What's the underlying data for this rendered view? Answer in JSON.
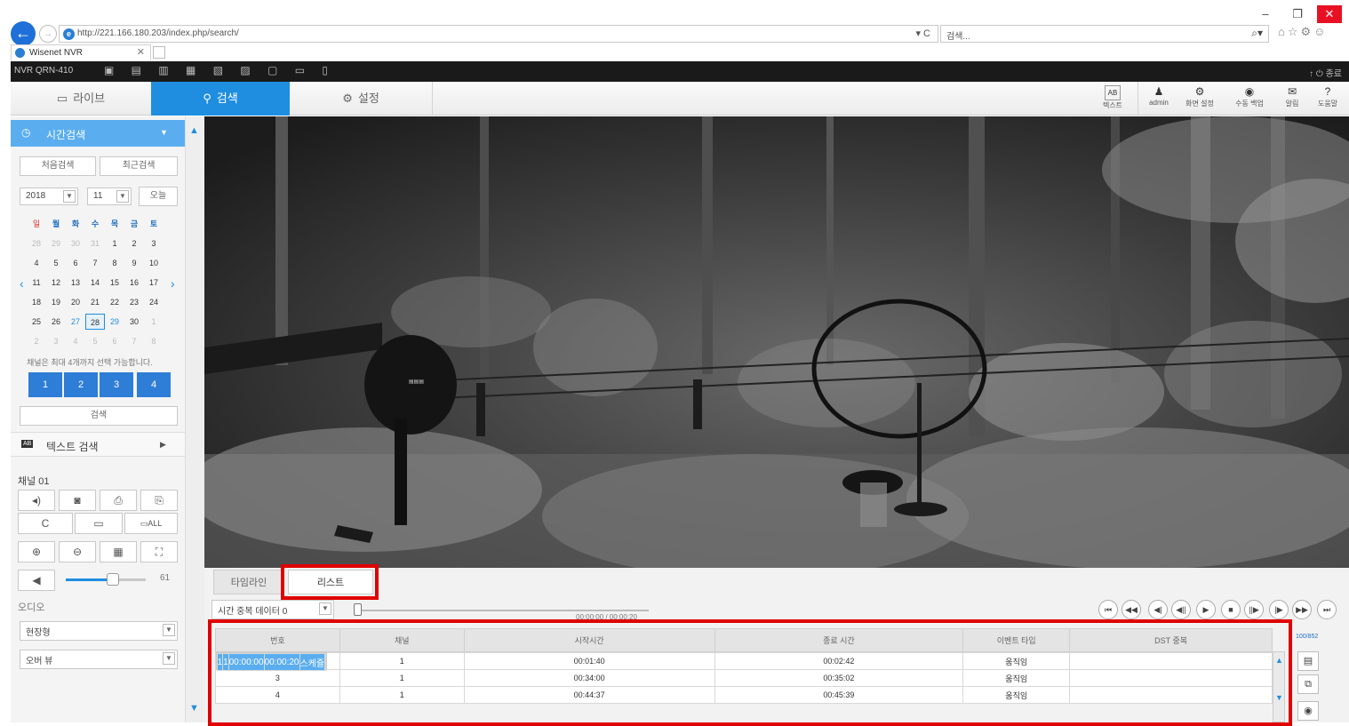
{
  "browser": {
    "url": "http://221.166.180.203/index.php/search/",
    "search_placeholder": "검색...",
    "tab_title": "Wisenet NVR",
    "refresh": "▾ C",
    "search_glyph": "⌕▾",
    "window_minimize": "–",
    "window_restore": "❐",
    "window_close": "✕",
    "tab_close": "✕",
    "toolbar_glyphs": "⌂☆⚙☺"
  },
  "app": {
    "model": "NVR QRN-410",
    "toolbar_glyphs": "▣ ▤ ▥ ▦ ▧ ▨ ▢ ▭ ▯",
    "top_right": "↑ ⏻ 종료"
  },
  "nav": {
    "live_label": "라이브",
    "search_label": "검색",
    "setup_label": "설정",
    "right_buttons": [
      {
        "icon": "AB",
        "label": "텍스트"
      },
      {
        "icon": "♟",
        "label": "admin"
      },
      {
        "icon": "⚙",
        "label": "화면 설정"
      },
      {
        "icon": "◉",
        "label": "수동 백업"
      },
      {
        "icon": "✉",
        "label": "알림"
      },
      {
        "icon": "?",
        "label": "도움말"
      }
    ]
  },
  "left": {
    "section_title": "시간검색",
    "first_search": "처음검색",
    "recent_search": "최근검색",
    "year": "2018",
    "month": "11",
    "today": "오늘",
    "weekdays": [
      "일",
      "월",
      "화",
      "수",
      "목",
      "금",
      "토"
    ],
    "weeks": [
      [
        "28",
        "29",
        "30",
        "31",
        "1",
        "2",
        "3"
      ],
      [
        "4",
        "5",
        "6",
        "7",
        "8",
        "9",
        "10"
      ],
      [
        "11",
        "12",
        "13",
        "14",
        "15",
        "16",
        "17"
      ],
      [
        "18",
        "19",
        "20",
        "21",
        "22",
        "23",
        "24"
      ],
      [
        "25",
        "26",
        "27",
        "28",
        "29",
        "30",
        "1"
      ],
      [
        "2",
        "3",
        "4",
        "5",
        "6",
        "7",
        "8"
      ]
    ],
    "notice": "채널은 최대 4개까지 선택 가능합니다.",
    "channels": [
      "1",
      "2",
      "3",
      "4"
    ],
    "search_btn": "검색",
    "text_search": "텍스트 검색",
    "text_search_icon": "AB",
    "channel_label": "채널 01",
    "volume_value": "61",
    "audio_label": "오디오",
    "dropdown1": "현장형",
    "dropdown2": "오버 뷰",
    "ctrl_glyphs": [
      "◂)",
      "◙",
      "⎙",
      "⎘",
      "C",
      "▭",
      "▭ALL",
      "⊕",
      "⊖",
      "▦",
      "⛶"
    ]
  },
  "bottom": {
    "tab_timeline": "타임라인",
    "tab_list": "리스트",
    "filter_select": "시간 중복 데이터 0",
    "timestamp": "00:00:00 / 00:00:20",
    "page_count": "100/852",
    "playback_buttons": [
      "⏮",
      "◀◀",
      "◀|",
      "◀||",
      "▶",
      "■",
      "||▶",
      "|▶",
      "▶▶",
      "⏭"
    ],
    "columns": [
      "번호",
      "채널",
      "시작시간",
      "종료 시간",
      "이벤트 타입",
      "DST 중복"
    ],
    "rows": [
      {
        "no": "1",
        "ch": "1",
        "start": "00:00:00",
        "end": "00:00:20",
        "event": "스케쥴",
        "dst": ""
      },
      {
        "no": "2",
        "ch": "1",
        "start": "00:01:40",
        "end": "00:02:42",
        "event": "움직임",
        "dst": ""
      },
      {
        "no": "3",
        "ch": "1",
        "start": "00:34:00",
        "end": "00:35:02",
        "event": "움직임",
        "dst": ""
      },
      {
        "no": "4",
        "ch": "1",
        "start": "00:44:37",
        "end": "00:45:39",
        "event": "움직임",
        "dst": ""
      }
    ]
  },
  "colors": {
    "accent": "#1f8ee0",
    "highlight": "#e00000"
  }
}
